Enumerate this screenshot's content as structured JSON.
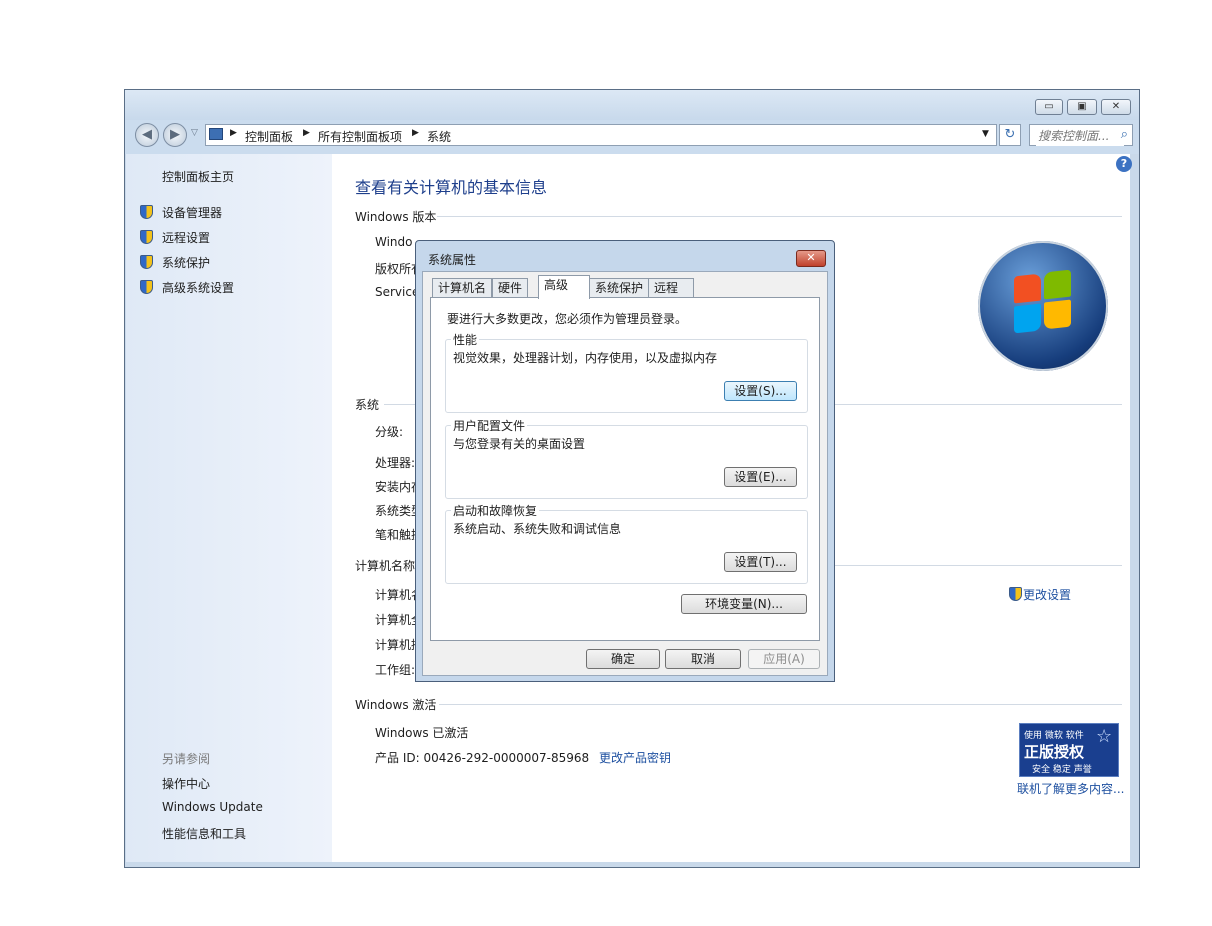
{
  "window": {
    "caption_buttons": {
      "minimize": "▭",
      "maximize": "▣",
      "close": "✕"
    },
    "nav": {
      "back": "◀",
      "forward": "▶",
      "recent": "▽"
    },
    "breadcrumb": [
      "控制面板",
      "所有控制面板项",
      "系统"
    ],
    "search_placeholder": "搜索控制面...",
    "refresh_glyph": "↻"
  },
  "sidebar": {
    "home": "控制面板主页",
    "tasks": [
      "设备管理器",
      "远程设置",
      "系统保护",
      "高级系统设置"
    ],
    "see_also_title": "另请参阅",
    "see_also": [
      "操作中心",
      "Windows Update",
      "性能信息和工具"
    ]
  },
  "main": {
    "heading": "查看有关计算机的基本信息",
    "edition_section": "Windows 版本",
    "edition_rows": [
      "Windo",
      "版权所有",
      "Service"
    ],
    "system_section": "系统",
    "system_rows": [
      "分级:",
      "处理器:",
      "安装内存",
      "系统类型",
      "笔和触摸"
    ],
    "computer_section": "计算机名称",
    "computer_rows": [
      "计算机名",
      "计算机全",
      "计算机描",
      "工作组:"
    ],
    "change_settings": "更改设置",
    "activation_section": "Windows 激活",
    "activated": "Windows 已激活",
    "product_id": "产品 ID: 00426-292-0000007-85968",
    "change_key": "更改产品密钥",
    "genuine": {
      "top": "使用 微软 软件",
      "main": "正版授权",
      "sub": "安全 稳定 声誉"
    },
    "learn_more": "联机了解更多内容..."
  },
  "dialog": {
    "title": "系统属性",
    "tabs": [
      "计算机名",
      "硬件",
      "高级",
      "系统保护",
      "远程"
    ],
    "active_tab": "高级",
    "admin_note": "要进行大多数更改，您必须作为管理员登录。",
    "groups": [
      {
        "title": "性能",
        "desc": "视觉效果，处理器计划，内存使用，以及虚拟内存",
        "button": "设置(S)..."
      },
      {
        "title": "用户配置文件",
        "desc": "与您登录有关的桌面设置",
        "button": "设置(E)..."
      },
      {
        "title": "启动和故障恢复",
        "desc": "系统启动、系统失败和调试信息",
        "button": "设置(T)..."
      }
    ],
    "env_button": "环境变量(N)...",
    "ok": "确定",
    "cancel": "取消",
    "apply": "应用(A)"
  },
  "colors": {
    "link": "#1e50a0",
    "window_frame": "#c9d9ea",
    "dialog_frame": "#c5d7eb"
  }
}
